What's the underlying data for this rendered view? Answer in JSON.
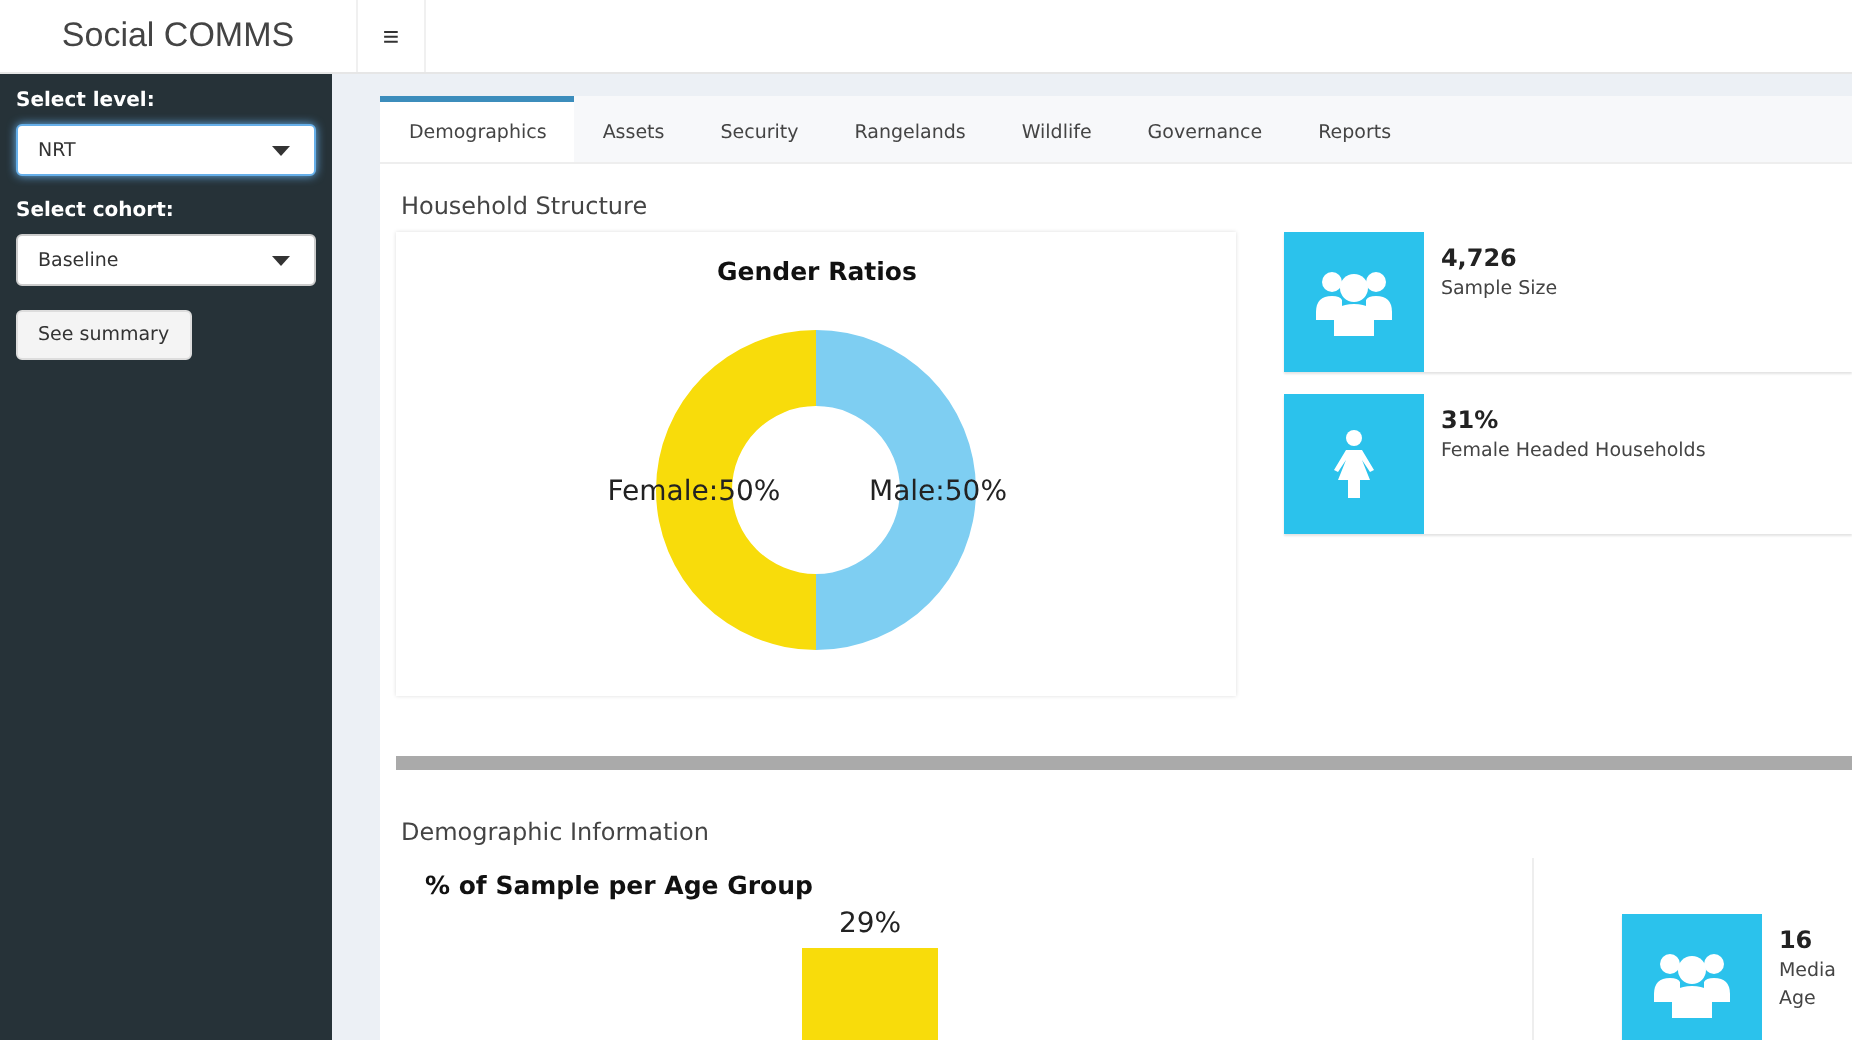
{
  "header": {
    "title": "Social COMMS",
    "menu_icon": "≡"
  },
  "sidebar": {
    "controls": [
      {
        "kind": "select",
        "label": "Select level:",
        "value": "NRT",
        "focused": true
      },
      {
        "kind": "select",
        "label": "Select cohort:",
        "value": "Baseline",
        "focused": false
      },
      {
        "kind": "button",
        "label": "See summary"
      }
    ]
  },
  "tabs": [
    {
      "label": "Demographics",
      "selected": true
    },
    {
      "label": "Assets",
      "selected": false
    },
    {
      "label": "Security",
      "selected": false
    },
    {
      "label": "Rangelands",
      "selected": false
    },
    {
      "label": "Wildlife",
      "selected": false
    },
    {
      "label": "Governance",
      "selected": false
    },
    {
      "label": "Reports",
      "selected": false
    }
  ],
  "household_structure": {
    "title": "Household Structure",
    "chart_data": {
      "type": "donut",
      "title": "Gender Ratios",
      "values": [
        50,
        50
      ],
      "colors": [
        "#f8dc0b",
        "#7ecef2"
      ],
      "value_labels": [
        "Female:50%",
        "Male:50%"
      ]
    },
    "info_boxes": [
      {
        "kind": "group",
        "value": "4,726",
        "label": "Sample Size"
      },
      {
        "kind": "woman",
        "value": "31%",
        "label": "Female Headed Households"
      }
    ]
  },
  "demographic_information": {
    "title": "Demographic Information",
    "age_chart": {
      "title": "% of Sample per Age Group",
      "bar_labels": [
        "29%"
      ]
    },
    "info_boxes": [
      {
        "kind": "group",
        "value": "16",
        "label_lines": [
          "Media",
          "Age"
        ]
      }
    ]
  }
}
